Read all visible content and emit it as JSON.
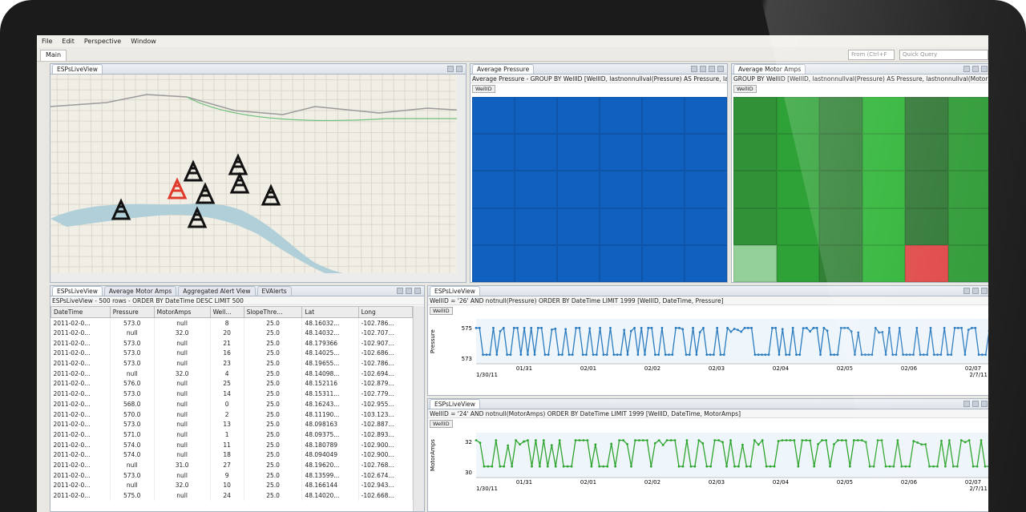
{
  "menu": [
    "File",
    "Edit",
    "Perspective",
    "Window"
  ],
  "toolbar": {
    "main_tab": "Main",
    "search1": "From (Ctrl+F",
    "search2": "Quick Query"
  },
  "map_panel": {
    "tab": "ESPsLiveView"
  },
  "pressure_panel": {
    "tab": "Average Pressure",
    "query": "Average Pressure - GROUP BY WellID [WellID, lastnonnullval(Pressure) AS Pressure, la",
    "group_btn": "WellID"
  },
  "amps_panel": {
    "tab": "Average Motor Amps",
    "query": "GROUP BY WellID [WellID, lastnonnullval(Pressure) AS Pressure, lastnonnullval(Motor",
    "group_btn": "WellID"
  },
  "table_panel": {
    "tabs": [
      "ESPsLiveView",
      "Average Motor Amps",
      "Aggregated Alert View",
      "EVAlerts"
    ],
    "query": "ESPsLiveView - 500 rows - ORDER BY DateTime DESC LIMIT 500",
    "columns": [
      "DateTime",
      "Pressure",
      "MotorAmps",
      "Well...",
      "SlopeThre...",
      "Lat",
      "Long"
    ],
    "rows": [
      [
        "2011-02-0...",
        "573.0",
        "null",
        "8",
        "25.0",
        "48.16032...",
        "-102.786..."
      ],
      [
        "2011-02-0...",
        "null",
        "32.0",
        "20",
        "25.0",
        "48.14032...",
        "-102.707..."
      ],
      [
        "2011-02-0...",
        "573.0",
        "null",
        "21",
        "25.0",
        "48.179366",
        "-102.907..."
      ],
      [
        "2011-02-0...",
        "573.0",
        "null",
        "16",
        "25.0",
        "48.14025...",
        "-102.686..."
      ],
      [
        "2011-02-0...",
        "573.0",
        "null",
        "23",
        "25.0",
        "48.19655...",
        "-102.786..."
      ],
      [
        "2011-02-0...",
        "null",
        "32.0",
        "4",
        "25.0",
        "48.14098...",
        "-102.694..."
      ],
      [
        "2011-02-0...",
        "576.0",
        "null",
        "25",
        "25.0",
        "48.152116",
        "-102.879..."
      ],
      [
        "2011-02-0...",
        "573.0",
        "null",
        "14",
        "25.0",
        "48.15311...",
        "-102.779..."
      ],
      [
        "2011-02-0...",
        "568.0",
        "null",
        "0",
        "25.0",
        "48.16243...",
        "-102.955..."
      ],
      [
        "2011-02-0...",
        "570.0",
        "null",
        "2",
        "25.0",
        "48.11190...",
        "-103.123..."
      ],
      [
        "2011-02-0...",
        "573.0",
        "null",
        "13",
        "25.0",
        "48.098163",
        "-102.887..."
      ],
      [
        "2011-02-0...",
        "571.0",
        "null",
        "1",
        "25.0",
        "48.09375...",
        "-102.893..."
      ],
      [
        "2011-02-0...",
        "574.0",
        "null",
        "11",
        "25.0",
        "48.180789",
        "-102.900..."
      ],
      [
        "2011-02-0...",
        "574.0",
        "null",
        "18",
        "25.0",
        "48.094049",
        "-102.900..."
      ],
      [
        "2011-02-0...",
        "null",
        "31.0",
        "27",
        "25.0",
        "48.19620...",
        "-102.768..."
      ],
      [
        "2011-02-0...",
        "573.0",
        "null",
        "9",
        "25.0",
        "48.13599...",
        "-102.674..."
      ],
      [
        "2011-02-0...",
        "null",
        "32.0",
        "10",
        "25.0",
        "48.166144",
        "-102.943..."
      ],
      [
        "2011-02-0...",
        "575.0",
        "null",
        "24",
        "25.0",
        "48.14020...",
        "-102.668..."
      ]
    ]
  },
  "pressure_chart": {
    "tab": "ESPsLiveView",
    "query": "WellID = '26' AND notnull(Pressure) ORDER BY DateTime LIMIT 1999 [WellID, DateTime, Pressure]",
    "group_btn": "WellID",
    "ylabel": "Pressure",
    "yticks": [
      "575",
      "573"
    ],
    "first_date": "1/30/11",
    "xticks": [
      "01/31",
      "02/01",
      "02/02",
      "02/03",
      "02/04",
      "02/05",
      "02/06",
      "02/07"
    ],
    "last_date": "2/7/11",
    "color": "#2b7bbf"
  },
  "amps_chart": {
    "tab": "ESPsLiveView",
    "query": "WellID = '24' AND notnull(MotorAmps) ORDER BY DateTime LIMIT 1999 [WellID, DateTime, MotorAmps]",
    "group_btn": "WellID",
    "ylabel": "MotorAmps",
    "yticks": [
      "32",
      "30"
    ],
    "first_date": "1/30/11",
    "xticks": [
      "01/31",
      "02/01",
      "02/02",
      "02/03",
      "02/04",
      "02/05",
      "02/06",
      "02/07"
    ],
    "last_date": "2/7/11",
    "color": "#2ea52e"
  },
  "colors": {
    "pressure_heat": "#1060c0",
    "amps_heat": "#2f9e35",
    "alert": "#e04848"
  }
}
